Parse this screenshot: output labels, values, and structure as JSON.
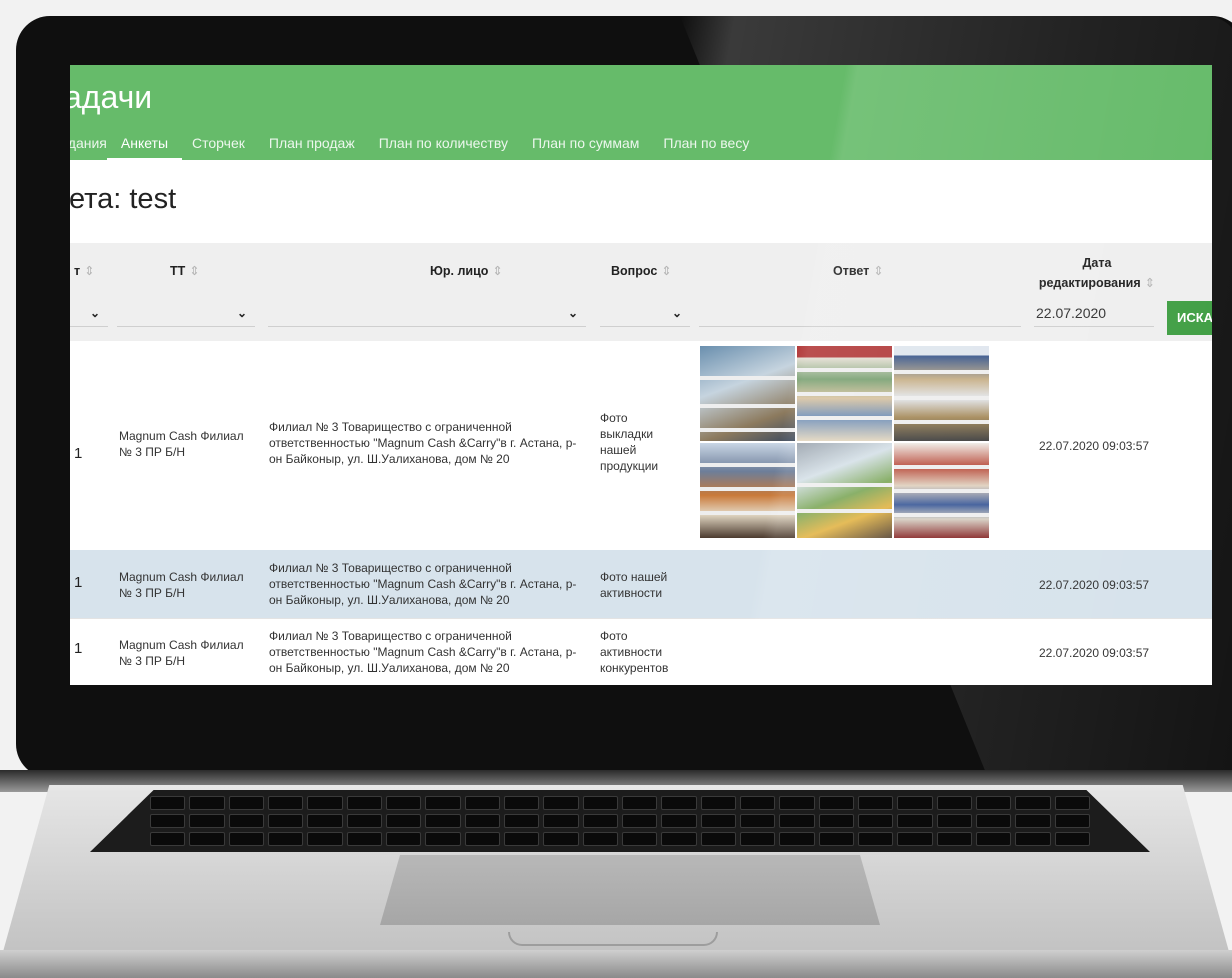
{
  "app": {
    "title": "адачи",
    "tabs": [
      {
        "label": "адания"
      },
      {
        "label": "Анкеты",
        "active": true
      },
      {
        "label": "Сторчек"
      },
      {
        "label": "План продаж"
      },
      {
        "label": "План по количеству"
      },
      {
        "label": "План по суммам"
      },
      {
        "label": "План по весу"
      }
    ],
    "accent_color": "#66bb6a",
    "button_color": "#43a047"
  },
  "page": {
    "heading": "кета: test"
  },
  "table": {
    "columns": [
      {
        "label": "т"
      },
      {
        "label": "ТТ"
      },
      {
        "label": "Юр. лицо"
      },
      {
        "label": "Вопрос"
      },
      {
        "label": "Ответ"
      },
      {
        "label_line1": "Дата",
        "label_line2": "редактирования"
      }
    ],
    "filters": {
      "date_value": "22.07.2020",
      "search_button": "ИСКА"
    },
    "rows": [
      {
        "num": "1",
        "tt": "Magnum Cash Филиал № 3 ПР Б/Н",
        "legal": "Филиал № 3 Товарищество с ограниченной ответственностью \"Magnum Cash &Carry\"в г. Астана, р-он Байконыр, ул. Ш.Уалиханова, дом № 20",
        "question": "Фото выкладки нашей продукции",
        "answer": "6 photos",
        "date": "22.07.2020 09:03:57"
      },
      {
        "num": "1",
        "tt": "Magnum Cash Филиал № 3 ПР Б/Н",
        "legal": "Филиал № 3 Товарищество с ограниченной ответственностью \"Magnum Cash &Carry\"в г. Астана, р-он Байконыр, ул. Ш.Уалиханова, дом № 20",
        "question": "Фото нашей активности",
        "date": "22.07.2020 09:03:57"
      },
      {
        "num": "1",
        "tt": "Magnum Cash Филиал № 3 ПР Б/Н",
        "legal": "Филиал № 3 Товарищество с ограниченной ответственностью \"Magnum Cash &Carry\"в г. Астана, р-он Байконыр, ул. Ш.Уалиханова, дом № 20",
        "question": "Фото активности конкурентов",
        "date": "22.07.2020 09:03:57"
      }
    ]
  }
}
